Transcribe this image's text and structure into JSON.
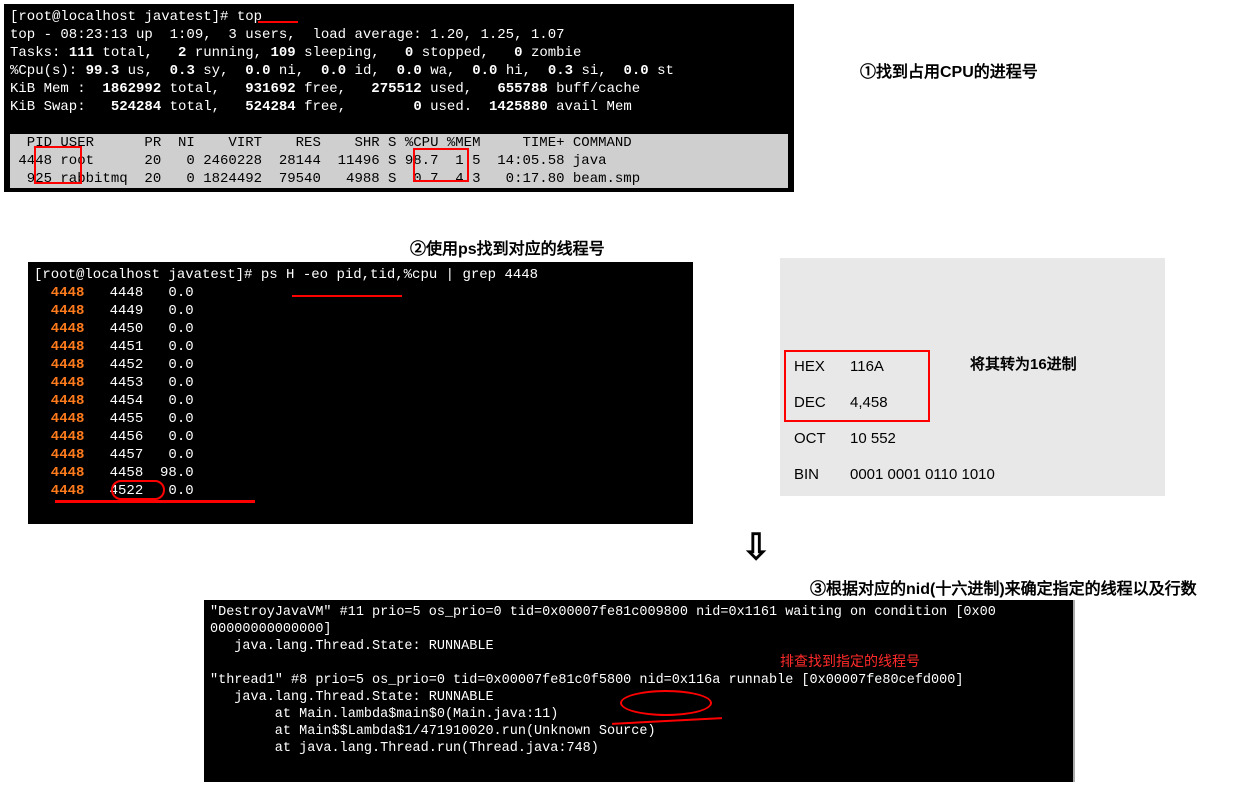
{
  "labels": {
    "step1": "①找到占用CPU的进程号",
    "step2": "②使用ps找到对应的线程号",
    "step3": "③根据对应的nid(十六进制)来确定指定的线程以及行数",
    "hex_title": "将其转为16进制",
    "jstack_note": "排查找到指定的线程号"
  },
  "top": {
    "prompt": "[root@localhost javatest]# top",
    "line1": "top - 08:23:13 up  1:09,  3 users,  load average: 1.20, 1.25, 1.07",
    "tasks": "Tasks: 111 total,   2 running, 109 sleeping,   0 stopped,   0 zombie",
    "cpu": "%Cpu(s): 99.3 us,  0.3 sy,  0.0 ni,  0.0 id,  0.0 wa,  0.0 hi,  0.3 si,  0.0 st",
    "mem": "KiB Mem :  1862992 total,   931692 free,   275512 used,   655788 buff/cache",
    "swap": "KiB Swap:   524284 total,   524284 free,        0 used.  1425880 avail Mem",
    "header": "  PID USER      PR  NI    VIRT    RES    SHR S %CPU %MEM     TIME+ COMMAND            ",
    "row1": " 4448 root      20   0 2460228  28144  11496 S 98.7  1.5  14:05.58 java               ",
    "row2": "  925 rabbitmq  20   0 1824492  79540   4988 S  0.7  4.3   0:17.80 beam.smp           "
  },
  "ps": {
    "prompt": "[root@localhost javatest]# ps H -eo pid,tid,%cpu | grep 4448",
    "rows": [
      {
        "pid": "4448",
        "tid": "4448",
        "cpu": "0.0"
      },
      {
        "pid": "4448",
        "tid": "4449",
        "cpu": "0.0"
      },
      {
        "pid": "4448",
        "tid": "4450",
        "cpu": "0.0"
      },
      {
        "pid": "4448",
        "tid": "4451",
        "cpu": "0.0"
      },
      {
        "pid": "4448",
        "tid": "4452",
        "cpu": "0.0"
      },
      {
        "pid": "4448",
        "tid": "4453",
        "cpu": "0.0"
      },
      {
        "pid": "4448",
        "tid": "4454",
        "cpu": "0.0"
      },
      {
        "pid": "4448",
        "tid": "4455",
        "cpu": "0.0"
      },
      {
        "pid": "4448",
        "tid": "4456",
        "cpu": "0.0"
      },
      {
        "pid": "4448",
        "tid": "4457",
        "cpu": "0.0"
      },
      {
        "pid": "4448",
        "tid": "4458",
        "cpu": "98.0"
      },
      {
        "pid": "4448",
        "tid": "4522",
        "cpu": "0.0"
      }
    ]
  },
  "hex": {
    "rows": [
      {
        "k": "HEX",
        "v": "116A"
      },
      {
        "k": "DEC",
        "v": "4,458"
      },
      {
        "k": "OCT",
        "v": "10 552"
      },
      {
        "k": "BIN",
        "v": "0001 0001 0110 1010"
      }
    ]
  },
  "jstack": {
    "l1": "\"DestroyJavaVM\" #11 prio=5 os_prio=0 tid=0x00007fe81c009800 nid=0x1161 waiting on condition [0x00",
    "l1b": "00000000000000]",
    "l2": "   java.lang.Thread.State: RUNNABLE",
    "l3": "",
    "l4": "\"thread1\" #8 prio=5 os_prio=0 tid=0x00007fe81c0f5800 nid=0x116a runnable [0x00007fe80cefd000]",
    "l5": "   java.lang.Thread.State: RUNNABLE",
    "l6": "        at Main.lambda$main$0(Main.java:11)",
    "l7": "        at Main$$Lambda$1/471910020.run(Unknown Source)",
    "l8": "        at java.lang.Thread.run(Thread.java:748)"
  }
}
